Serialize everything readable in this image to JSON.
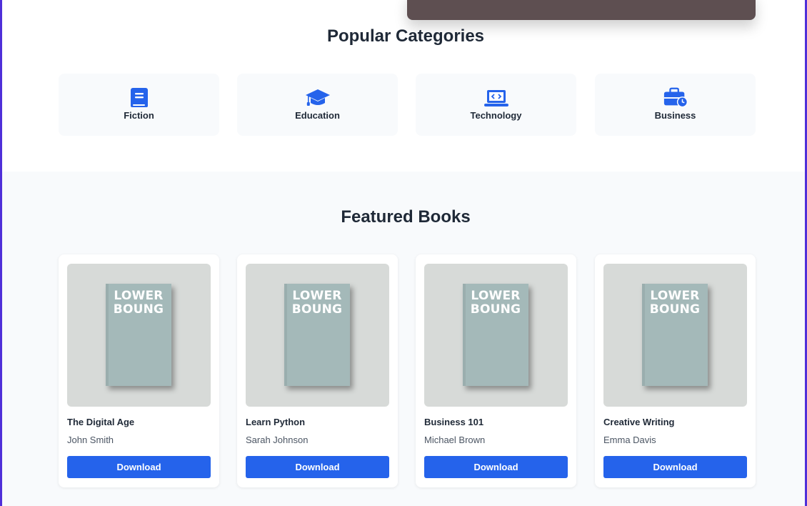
{
  "categories_section": {
    "title": "Popular Categories",
    "items": [
      {
        "label": "Fiction",
        "icon": "book-icon"
      },
      {
        "label": "Education",
        "icon": "graduation-cap-icon"
      },
      {
        "label": "Technology",
        "icon": "laptop-code-icon"
      },
      {
        "label": "Business",
        "icon": "briefcase-clock-icon"
      }
    ]
  },
  "featured_section": {
    "title": "Featured Books",
    "cover_text_line1": "LOWER",
    "cover_text_line2": "BOUNG",
    "books": [
      {
        "title": "The Digital Age",
        "author": "John Smith",
        "button": "Download"
      },
      {
        "title": "Learn Python",
        "author": "Sarah Johnson",
        "button": "Download"
      },
      {
        "title": "Business 101",
        "author": "Michael Brown",
        "button": "Download"
      },
      {
        "title": "Creative Writing",
        "author": "Emma Davis",
        "button": "Download"
      }
    ]
  },
  "colors": {
    "accent": "#2563eb",
    "frame_border": "#4f2fd9",
    "section_bg": "#f8fafc",
    "cover": "#a4b9b9",
    "cover_backdrop": "#d7dad8"
  }
}
